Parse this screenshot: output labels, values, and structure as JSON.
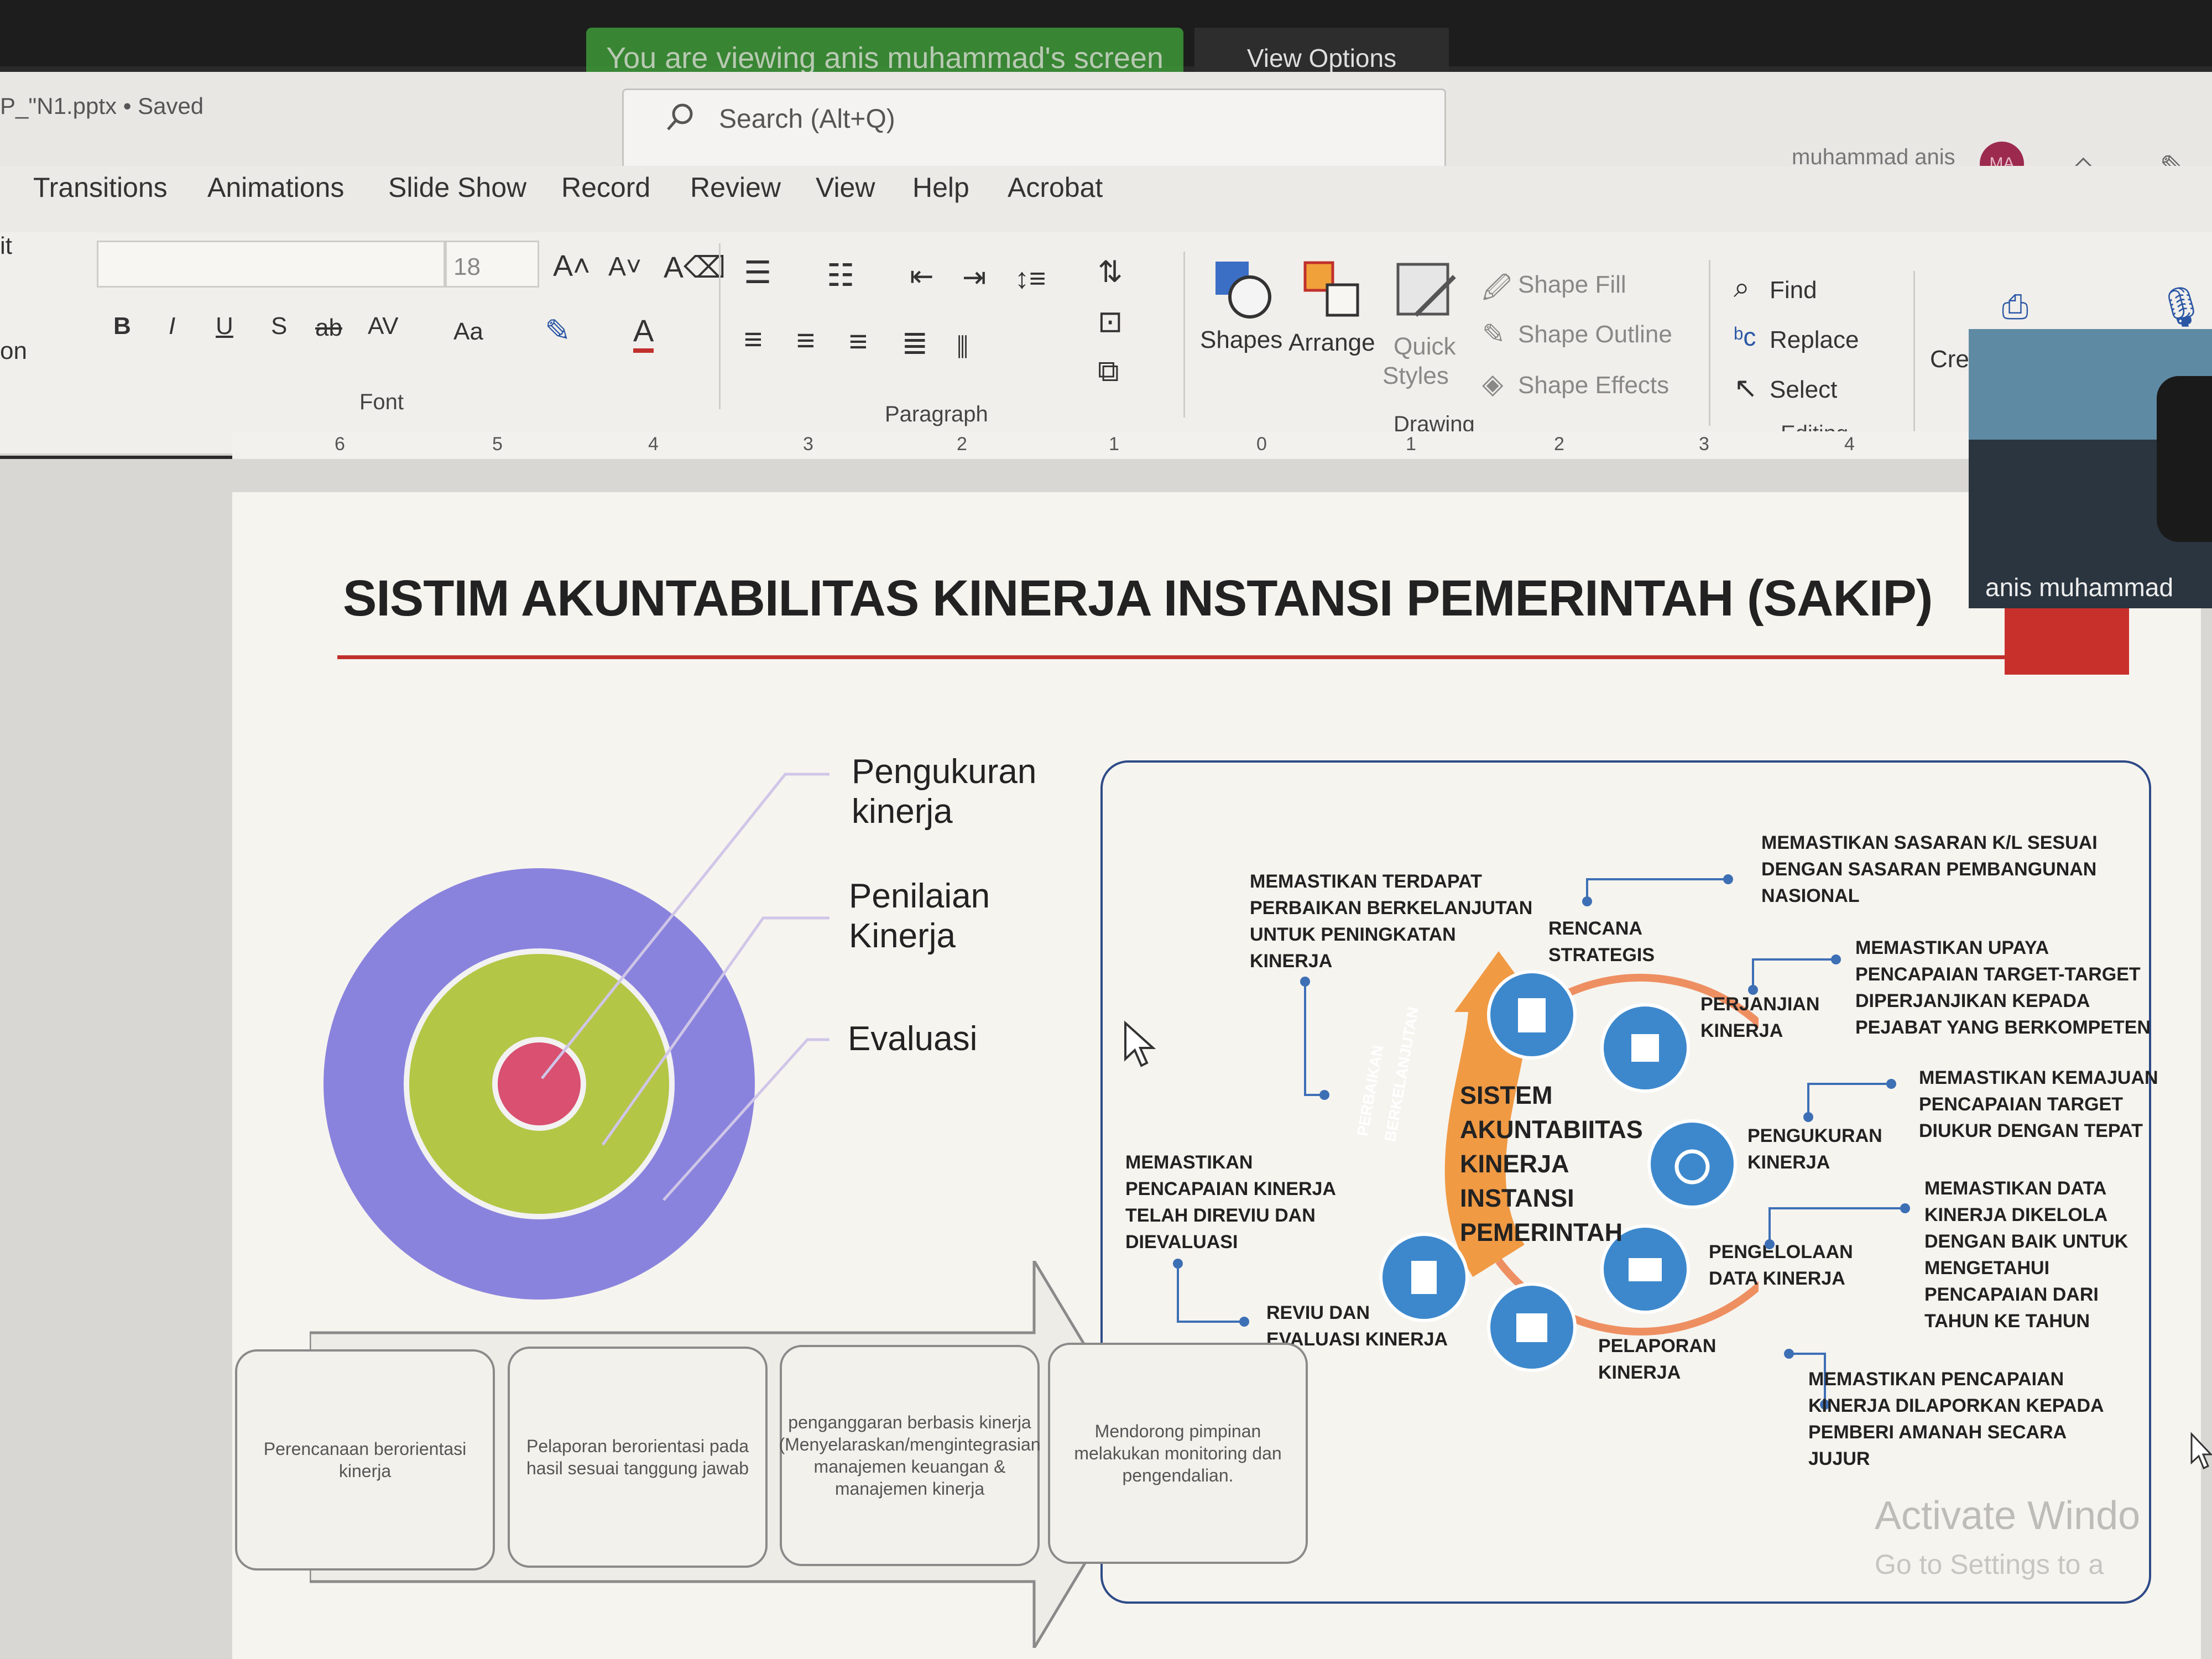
{
  "zoom": {
    "share_banner": "You are viewing anis muhammad's screen",
    "view_options": "View Options"
  },
  "titlebar": {
    "file_name": "P_\"N1.pptx • Saved",
    "search_placeholder": "Search (Alt+Q)",
    "user_name": "muhammad anis",
    "avatar_initials": "MA"
  },
  "menu": {
    "tabs": [
      "Transitions",
      "Animations",
      "Slide Show",
      "Record",
      "Review",
      "View",
      "Help",
      "Acrobat"
    ]
  },
  "ribbon": {
    "font": {
      "size": "18",
      "label": "Font",
      "bold": "B",
      "italic": "I",
      "underline": "U",
      "shadow": "S",
      "strike": "ab",
      "spacing": "AV",
      "case": "Aa"
    },
    "paragraph": {
      "label": "Paragraph"
    },
    "drawing": {
      "label": "Drawing",
      "shapes": "Shapes",
      "arrange": "Arrange",
      "quick_styles_1": "Quick",
      "quick_styles_2": "Styles",
      "shape_fill": "Shape Fill",
      "shape_outline": "Shape Outline",
      "shape_effects": "Shape Effects"
    },
    "editing": {
      "label": "Editing",
      "find": "Find",
      "replace": "Replace",
      "select": "Select"
    },
    "left_cut_1": "it",
    "left_cut_2": "on",
    "cre": "Cre"
  },
  "ruler": [
    "6",
    "5",
    "4",
    "3",
    "2",
    "1",
    "0",
    "1",
    "2",
    "3",
    "4"
  ],
  "webcam": {
    "name": "anis muhammad"
  },
  "slide": {
    "title": "SISTIM AKUNTABILITAS KINERJA INSTANSI PEMERINTAH (SAKIP)",
    "rings": {
      "outer_label_1": "Pengukuran",
      "outer_label_2": "kinerja",
      "middle_label_1": "Penilaian",
      "middle_label_2": "Kinerja",
      "inner_label": "Evaluasi"
    },
    "cycle": {
      "center": [
        "SISTEM",
        "AKUNTABIITAS",
        "KINERJA",
        "INSTANSI",
        "PEMERINTAH"
      ],
      "arrow_text_1": "PERBAIKAN",
      "arrow_text_2": "BERKELANJUTAN",
      "nodes": {
        "rencana": [
          "RENCANA",
          "STRATEGIS"
        ],
        "perjanjian": [
          "PERJANJIAN",
          "KINERJA"
        ],
        "pengukuran": [
          "PENGUKURAN",
          "KINERJA"
        ],
        "pengelolaan": [
          "PENGELOLAAN",
          "DATA KINERJA"
        ],
        "pelaporan": [
          "PELAPORAN",
          "KINERJA"
        ],
        "reviu": [
          "REVIU DAN",
          "EVALUASI KINERJA"
        ]
      },
      "notes": {
        "perbaikan": [
          "MEMASTIKAN TERDAPAT",
          "PERBAIKAN BERKELANJUTAN",
          "UNTUK PENINGKATAN",
          "KINERJA"
        ],
        "rencana": [
          "MEMASTIKAN SASARAN K/L SESUAI",
          "DENGAN SASARAN PEMBANGUNAN",
          "NASIONAL"
        ],
        "perjanjian": [
          "MEMASTIKAN UPAYA",
          "PENCAPAIAN TARGET-TARGET",
          "DIPERJANJIKAN KEPADA",
          "PEJABAT YANG BERKOMPETEN"
        ],
        "pengukuran": [
          "MEMASTIKAN KEMAJUAN",
          "PENCAPAIAN TARGET",
          "DIUKUR DENGAN TEPAT"
        ],
        "pengelolaan": [
          "MEMASTIKAN DATA",
          "KINERJA DIKELOLA",
          "DENGAN BAIK UNTUK",
          "MENGETAHUI",
          "PENCAPAIAN DARI",
          "TAHUN KE TAHUN"
        ],
        "pelaporan": [
          "MEMASTIKAN PENCAPAIAN",
          "KINERJA DILAPORKAN KEPADA",
          "PEMBERI AMANAH SECARA",
          "JUJUR"
        ],
        "reviu": [
          "MEMASTIKAN",
          "PENCAPAIAN KINERJA",
          "TELAH DIREVIU DAN",
          "DIEVALUASI"
        ]
      }
    },
    "steps": [
      "Perencanaan berorientasi kinerja",
      "Pelaporan berorientasi pada hasil sesuai tanggung jawab",
      "penganggaran berbasis kinerja (Menyelaraskan/mengintegrasian manajemen keuangan & manajemen kinerja",
      "Mendorong pimpinan melakukan monitoring dan pengendalian."
    ]
  },
  "watermark": {
    "line1": "Activate Windo",
    "line2": "Go to Settings to a"
  }
}
